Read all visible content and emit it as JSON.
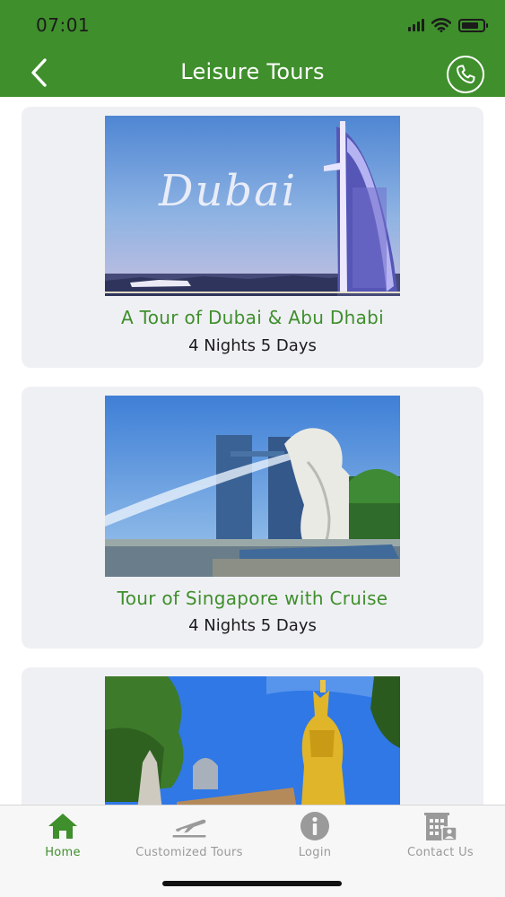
{
  "status_bar": {
    "time": "07:01"
  },
  "header": {
    "title": "Leisure Tours"
  },
  "tours": [
    {
      "image_caption": "Dubai",
      "title": "A Tour of Dubai & Abu Dhabi",
      "duration": "4 Nights 5 Days"
    },
    {
      "title": "Tour of Singapore with Cruise",
      "duration": "4 Nights 5 Days"
    },
    {}
  ],
  "tabbar": {
    "items": [
      {
        "label": "Home",
        "icon": "home-icon",
        "active": true
      },
      {
        "label": "Customized Tours",
        "icon": "airplane-takeoff-icon",
        "active": false
      },
      {
        "label": "Login",
        "icon": "info-icon",
        "active": false
      },
      {
        "label": "Contact Us",
        "icon": "building-contact-icon",
        "active": false
      }
    ]
  },
  "colors": {
    "brand_green": "#3f8f2c",
    "card_background": "#eff0f4",
    "tab_inactive": "#9a9a9a"
  }
}
